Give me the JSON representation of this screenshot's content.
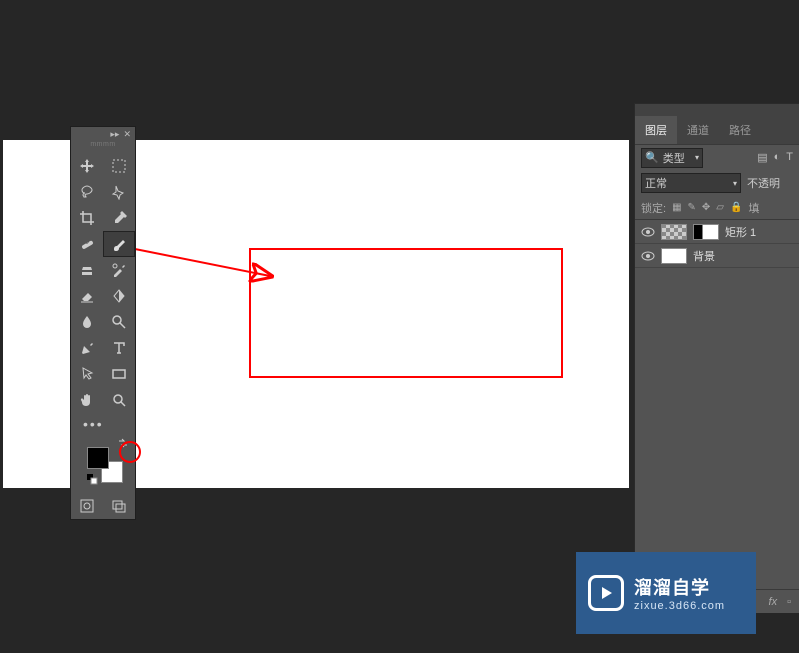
{
  "tool_panel": {
    "header": "▸▸",
    "label": "mmmm"
  },
  "layers_panel": {
    "tabs": {
      "layers": "图层",
      "channels": "通道",
      "paths": "路径"
    },
    "filter_label": "类型",
    "blend_mode": "正常",
    "opacity_label": "不透明",
    "lock_label": "锁定:",
    "fill_label": "填",
    "layers": [
      {
        "name": "矩形 1"
      },
      {
        "name": "背景"
      }
    ],
    "fx_label": "fx"
  },
  "watermark": {
    "title": "溜溜自学",
    "subtitle": "zixue.3d66.com"
  },
  "icons": {
    "search": "🔍",
    "image": "▤",
    "adjust": "◐",
    "type_filter": "T",
    "checker": "▦",
    "brush_lock": "✎",
    "move_lock": "✥",
    "crop_lock": "▱",
    "lock": "🔒"
  }
}
